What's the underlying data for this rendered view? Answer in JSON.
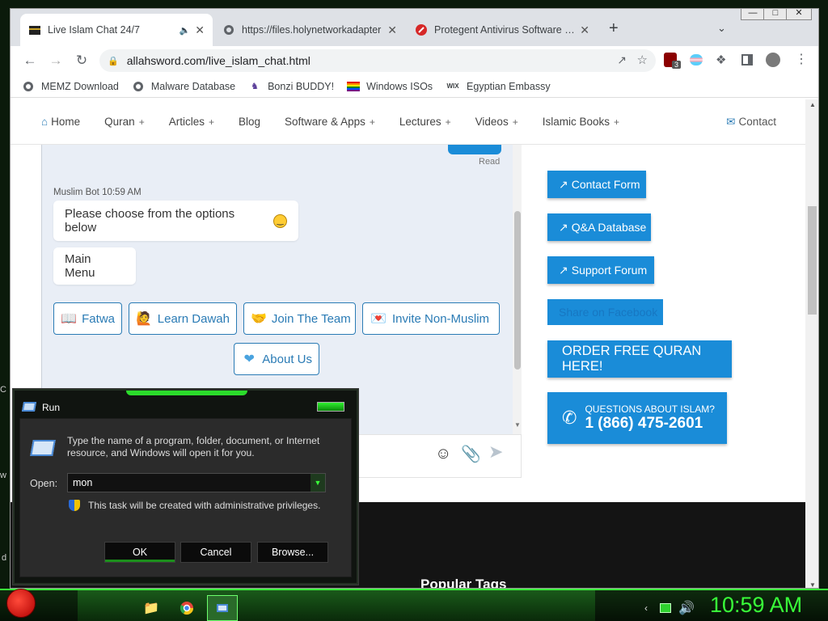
{
  "desktop": {
    "side_letters": [
      "C",
      "w",
      "d"
    ]
  },
  "browser": {
    "tabs": [
      {
        "title": "Live Islam Chat 24/7",
        "active": true
      },
      {
        "title": "https://files.holynetworkadapter",
        "active": false
      },
      {
        "title": "Protegent Antivirus Software | Do",
        "active": false
      }
    ],
    "new_tab_symbol": "+",
    "url": "allahsword.com/live_islam_chat.html",
    "extension_badge": "3",
    "bookmarks": [
      "MEMZ Download",
      "Malware Database",
      "Bonzi BUDDY!",
      "Windows ISOs",
      "Egyptian Embassy"
    ]
  },
  "site": {
    "nav": [
      {
        "label": "Home",
        "plus": false
      },
      {
        "label": "Quran",
        "plus": true
      },
      {
        "label": "Articles",
        "plus": true
      },
      {
        "label": "Blog",
        "plus": false
      },
      {
        "label": "Software & Apps",
        "plus": true
      },
      {
        "label": "Lectures",
        "plus": true
      },
      {
        "label": "Videos",
        "plus": true
      },
      {
        "label": "Islamic Books",
        "plus": true
      }
    ],
    "plus_symbol": "+",
    "contact_label": "Contact",
    "chat": {
      "read_label": "Read",
      "bot_meta": "Muslim Bot 10:59 AM",
      "message": "Please choose from the options below",
      "main_menu": "Main Menu",
      "options": [
        "Fatwa",
        "Learn Dawah",
        "Join The Team",
        "Invite Non-Muslim",
        "About Us"
      ]
    },
    "sidebar": {
      "contact_form": "Contact Form",
      "qa_database": "Q&A Database",
      "support_forum": "Support Forum",
      "hidden_button": "Share on Facebook",
      "order_quran": "ORDER FREE QURAN HERE!",
      "questions": "QUESTIONS ABOUT ISLAM?",
      "phone": "1 (866) 475-2601"
    },
    "footer_heading": "Popular Tags"
  },
  "run_dialog": {
    "title": "Run",
    "description": "Type the name of a program, folder, document, or Internet resource, and Windows will open it for you.",
    "open_label": "Open:",
    "input_value": "mon",
    "admin_note": "This task will be created with administrative privileges.",
    "ok": "OK",
    "cancel": "Cancel",
    "browse": "Browse..."
  },
  "taskbar": {
    "clock": "10:59 AM"
  },
  "colors": {
    "accent": "#1a8cd8",
    "link": "#2a7bb5",
    "taskbar_green": "#3aff3a",
    "clock": "#39ff39"
  }
}
